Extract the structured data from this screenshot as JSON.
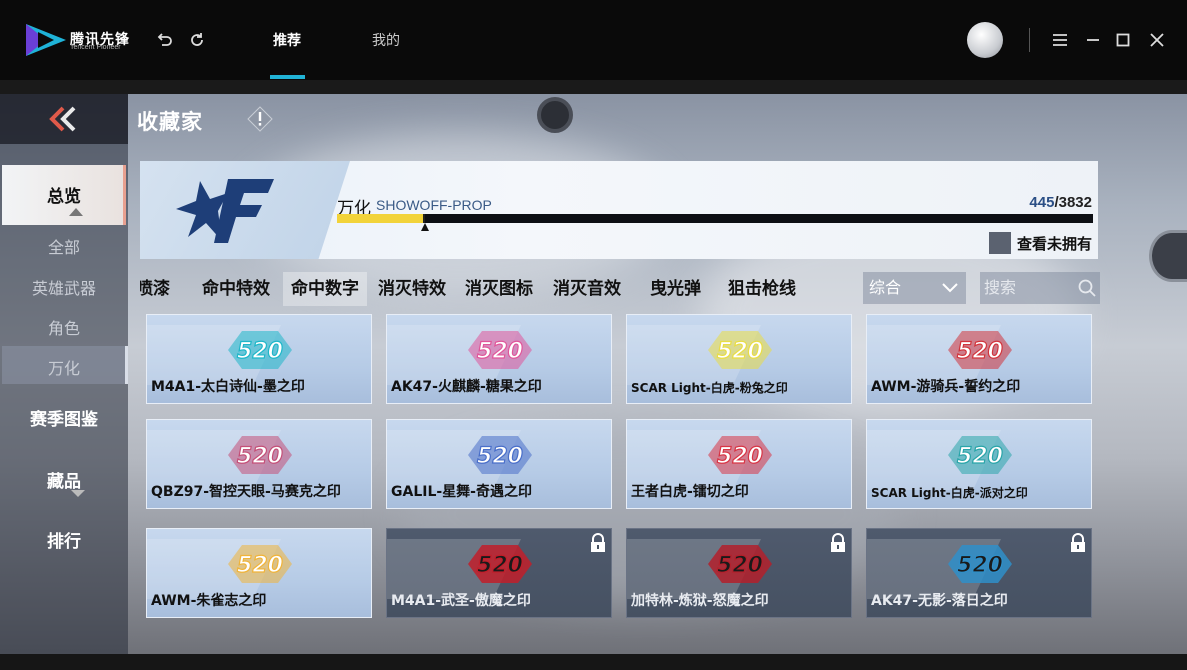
{
  "titlebar": {
    "brand": "腾讯先锋",
    "brand_sub": "Tencent Pioneer",
    "tabs": [
      {
        "label": "推荐",
        "active": true
      },
      {
        "label": "我的",
        "active": false
      }
    ],
    "accent": "#21b3d6"
  },
  "game": {
    "page_title": "收藏家",
    "nav": {
      "overview": "总览",
      "sub_items": [
        "全部",
        "英雄武器",
        "角色",
        "万化"
      ],
      "active_sub": "万化",
      "season": "赛季图鉴",
      "collection": "藏品",
      "ranking": "排行"
    },
    "banner": {
      "name": "万化",
      "name_en": "SHOWOFF-PROP",
      "owned": "445",
      "total": "/3832",
      "progress_fraction": 0.116,
      "show_unowned_label": "查看未拥有"
    },
    "filter_tabs": [
      {
        "label": "喷漆",
        "active": false
      },
      {
        "label": "命中特效",
        "active": false
      },
      {
        "label": "命中数字",
        "active": true
      },
      {
        "label": "消灭特效",
        "active": false
      },
      {
        "label": "消灭图标",
        "active": false
      },
      {
        "label": "消灭音效",
        "active": false
      },
      {
        "label": "曳光弹",
        "active": false
      },
      {
        "label": "狙击枪线",
        "active": false
      }
    ],
    "sort_label": "综合",
    "search_placeholder": "搜索",
    "emblem_text": "520",
    "items": [
      {
        "name": "M4A1-太白诗仙-墨之印",
        "locked": false,
        "color": "#1fb7c9"
      },
      {
        "name": "AK47-火麒麟-糖果之印",
        "locked": false,
        "color": "#e0569a"
      },
      {
        "name": "SCAR Light-白虎-粉兔之印",
        "locked": false,
        "color": "#e9dd45"
      },
      {
        "name": "AWM-游骑兵-誓约之印",
        "locked": false,
        "color": "#d2353c"
      },
      {
        "name": "QBZ97-智控天眼-马赛克之印",
        "locked": false,
        "color": "#c45078"
      },
      {
        "name": "GALIL-星舞-奇遇之印",
        "locked": false,
        "color": "#4a6fc9"
      },
      {
        "name": "王者白虎-镭切之印",
        "locked": false,
        "color": "#d83545"
      },
      {
        "name": "SCAR Light-白虎-派对之印",
        "locked": false,
        "color": "#2aa5a9"
      },
      {
        "name": "AWM-朱雀志之印",
        "locked": false,
        "color": "#f0b43a"
      },
      {
        "name": "M4A1-武圣-傲魔之印",
        "locked": true,
        "color": "#c11e2a"
      },
      {
        "name": "加特林-炼狱-怒魔之印",
        "locked": true,
        "color": "#b3202b"
      },
      {
        "name": "AK47-无影-落日之印",
        "locked": true,
        "color": "#2f8fc9"
      }
    ]
  }
}
